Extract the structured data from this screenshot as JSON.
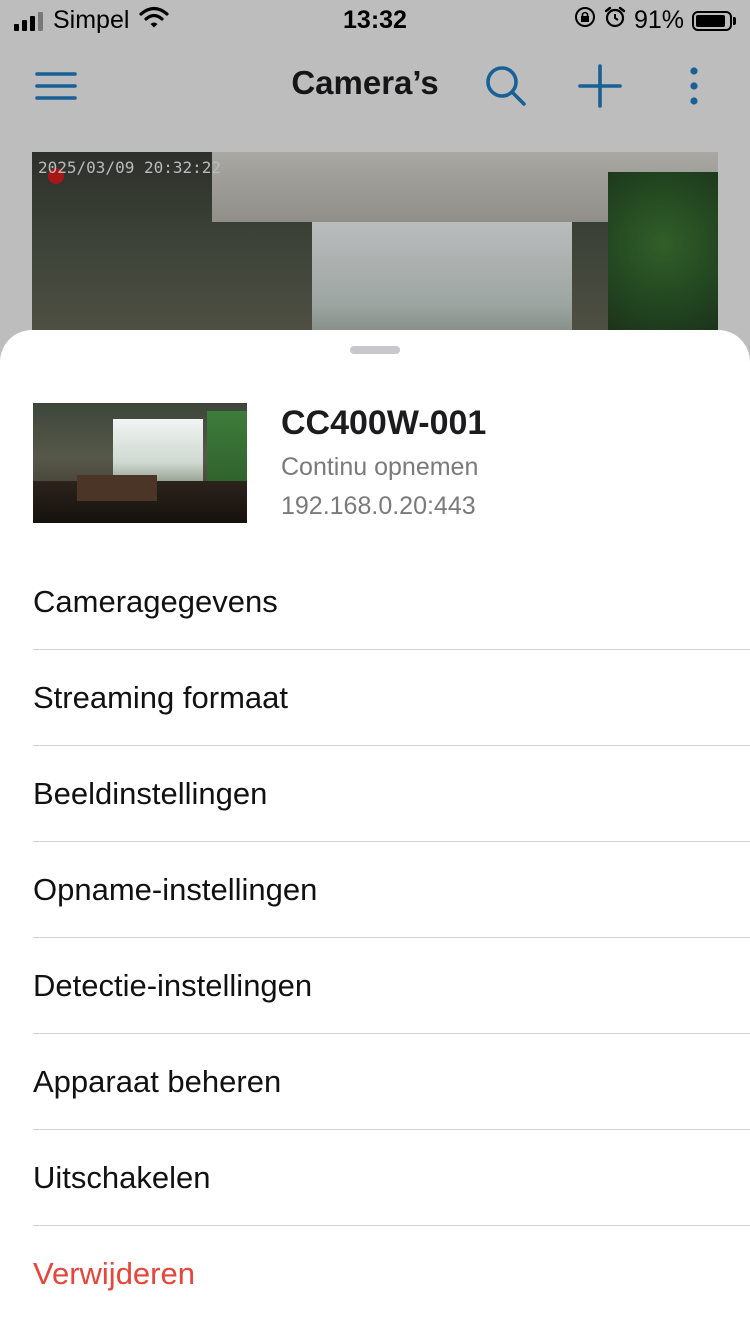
{
  "status_bar": {
    "carrier": "Simpel",
    "time": "13:32",
    "battery_percent": "91%",
    "battery_level": 0.91,
    "icons": [
      "signal-icon",
      "wifi-icon",
      "orientation-lock-icon",
      "alarm-icon",
      "battery-icon"
    ]
  },
  "nav": {
    "title": "Camera’s",
    "icons": [
      "menu-icon",
      "search-icon",
      "add-icon",
      "more-icon"
    ],
    "accent_color": "#1f7bbf"
  },
  "preview": {
    "timestamp": "2025/03/09 20:32:22",
    "recording_color": "#d81e1e"
  },
  "device": {
    "name": "CC400W-001",
    "status": "Continu opnemen",
    "address": "192.168.0.20:443"
  },
  "menu": {
    "items": [
      {
        "label": "Cameragegevens"
      },
      {
        "label": "Streaming formaat"
      },
      {
        "label": "Beeldinstellingen"
      },
      {
        "label": "Opname-instellingen"
      },
      {
        "label": "Detectie-instellingen"
      },
      {
        "label": "Apparaat beheren"
      },
      {
        "label": "Uitschakelen"
      },
      {
        "label": "Verwijderen"
      }
    ],
    "danger_color": "#e8443a"
  }
}
